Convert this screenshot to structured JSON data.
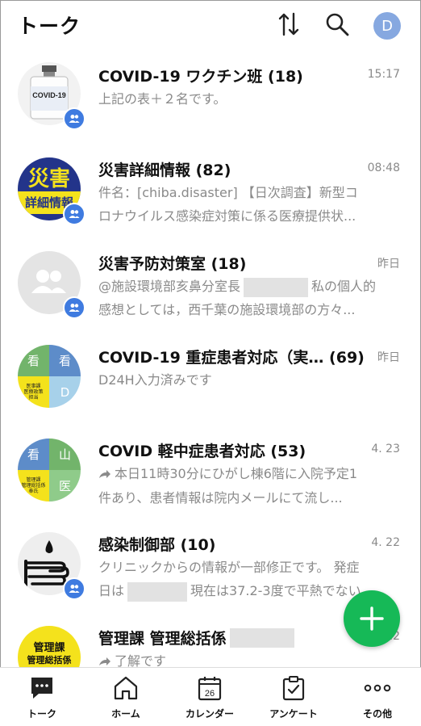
{
  "header": {
    "title": "トーク",
    "user_initial": "D"
  },
  "chats": [
    {
      "name": "COVID-19 ワクチン班 (18)",
      "time": "15:17",
      "preview": [
        "上記の表＋２名です。"
      ],
      "avatar_text": "COVID-19",
      "avatar_sub": "Coronavirus Vaccine"
    },
    {
      "name": "災害詳細情報 (82)",
      "time": "08:48",
      "preview": [
        "件名：[chiba.disaster] 【日次調査】新型コ",
        "ロナウイルス感染症対策に係る医療提供状..."
      ],
      "avatar_line1": "災害",
      "avatar_line2": "詳細情報"
    },
    {
      "name": "災害予防対策室 (18)",
      "time": "昨日",
      "preview_a": "@施設環境部亥鼻分室長",
      "preview_b": "私の個人的",
      "preview_2": "感想としては，西千葉の施設環境部の方々..."
    },
    {
      "name": "COVID-19 重症患者対応（実… (69)",
      "time": "昨日",
      "preview": [
        "D24H入力済みです"
      ],
      "avatar_cells": [
        "看",
        "看",
        "医事課\n医療政策\n担当",
        "D"
      ]
    },
    {
      "name": "COVID 軽中症患者対応 (53)",
      "time": "4. 23",
      "preview_1": "本日11時30分にひがし棟6階に入院予定1",
      "preview_2": "件あり、患者情報は院内メールにて流し...",
      "avatar_cells": [
        "看",
        "山",
        "管理課\n管理総括係\n奉氏",
        "医"
      ]
    },
    {
      "name": "感染制御部 (10)",
      "time": "4. 22",
      "preview_1": "クリニックからの情報が一部修正です。 発症",
      "preview_2a": "日は",
      "preview_2b": "現在は37.2-3度で平熱でない..."
    },
    {
      "name": "管理課 管理総括係",
      "time": "22",
      "preview_1": "了解です",
      "avatar_line1": "管理課",
      "avatar_line2": "管理総括係"
    }
  ],
  "tabs": [
    {
      "label": "トーク",
      "icon": "chat-bubble-icon"
    },
    {
      "label": "ホーム",
      "icon": "home-icon"
    },
    {
      "label": "カレンダー",
      "icon": "calendar-icon",
      "day": "26"
    },
    {
      "label": "アンケート",
      "icon": "survey-icon"
    },
    {
      "label": "その他",
      "icon": "more-icon"
    }
  ],
  "colors": {
    "accent": "#16b957",
    "badge": "#3f7be0",
    "avatar": "#86a8e0"
  }
}
